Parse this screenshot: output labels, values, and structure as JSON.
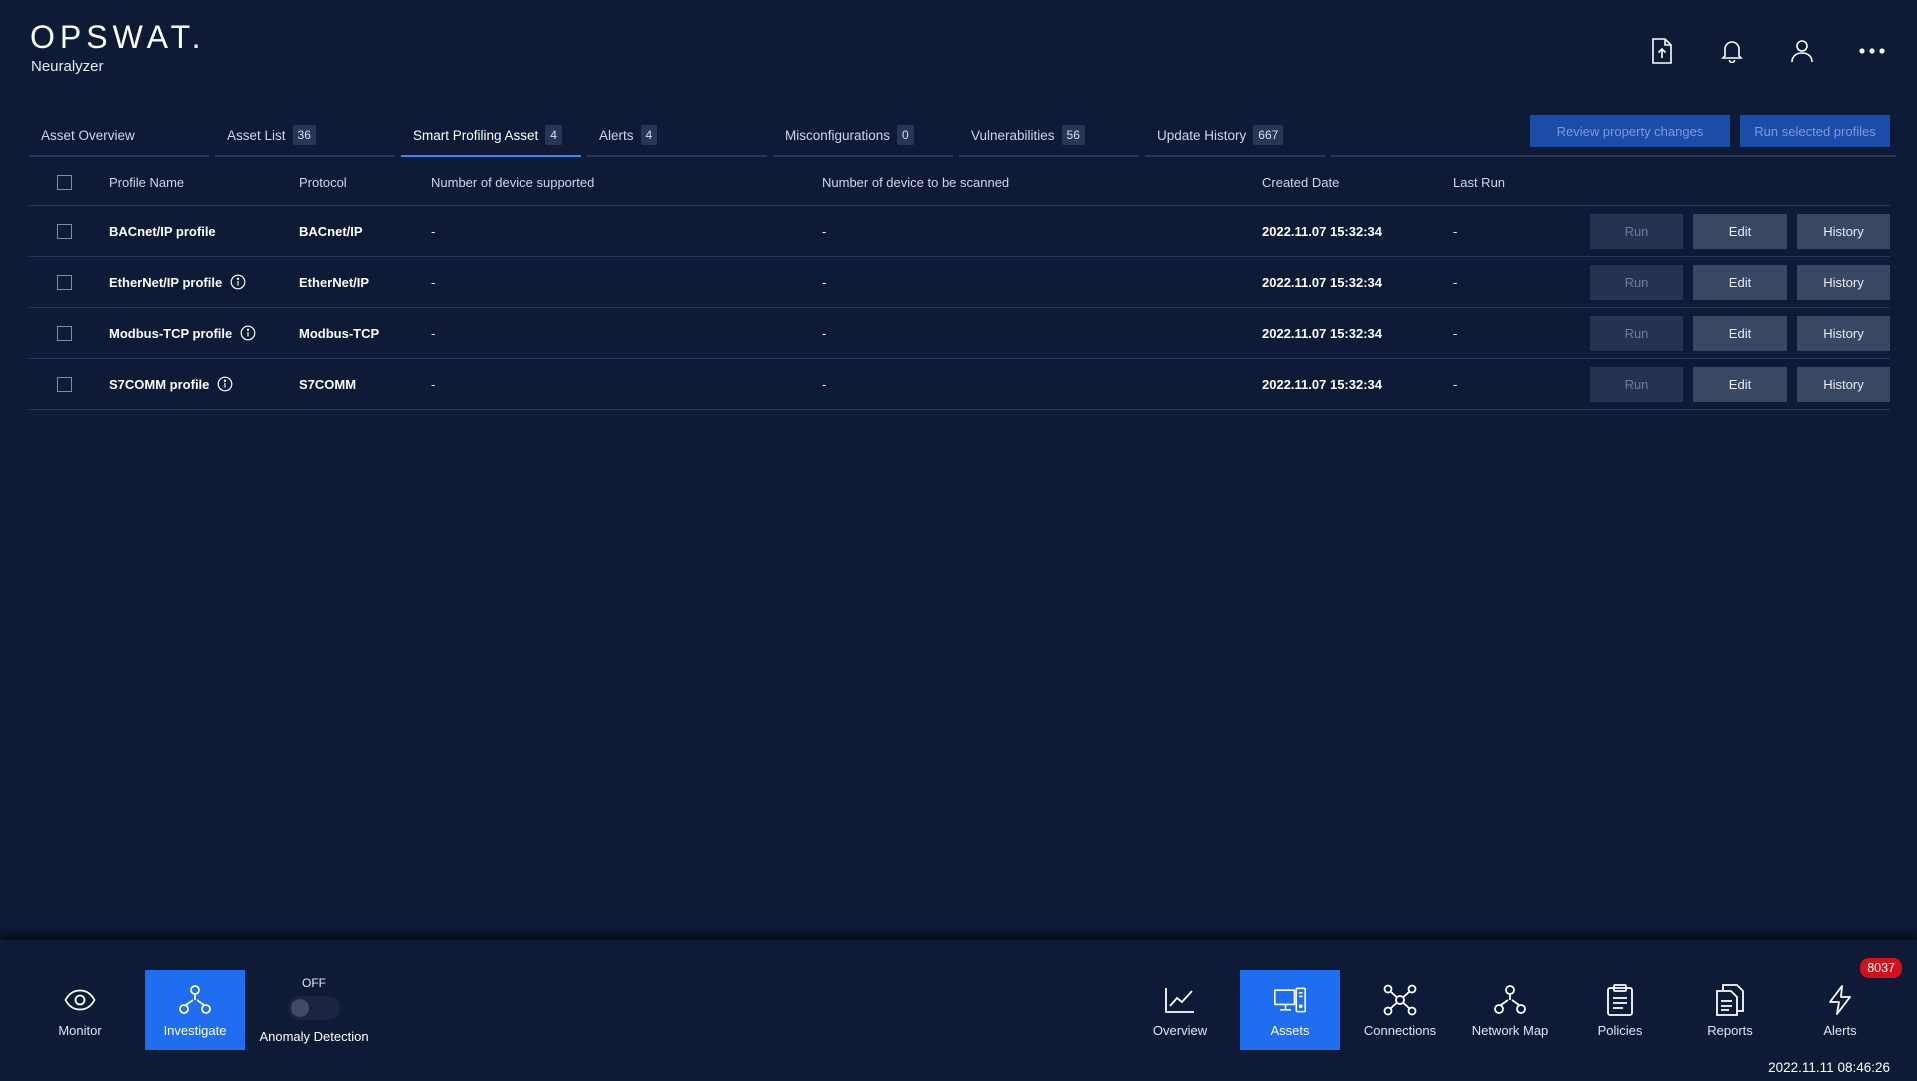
{
  "header": {
    "brand": "OPSWAT.",
    "product": "Neuralyzer",
    "icons": [
      "upload-file-icon",
      "bell-icon",
      "user-icon",
      "more-icon"
    ]
  },
  "tabs": [
    {
      "label": "Asset Overview",
      "count": ""
    },
    {
      "label": "Asset List",
      "count": "36"
    },
    {
      "label": "Smart Profiling Asset",
      "count": "4"
    },
    {
      "label": "Alerts",
      "count": "4"
    },
    {
      "label": "Misconfigurations",
      "count": "0"
    },
    {
      "label": "Vulnerabilities",
      "count": "56"
    },
    {
      "label": "Update History",
      "count": "667"
    }
  ],
  "actions": {
    "review": "Review property changes",
    "run_selected": "Run selected profiles"
  },
  "table": {
    "columns": {
      "profile_name": "Profile Name",
      "protocol": "Protocol",
      "num_supported": "Number of device supported",
      "num_scanned": "Number of device to be scanned",
      "created": "Created Date",
      "last_run": "Last Run"
    },
    "buttons": {
      "run": "Run",
      "edit": "Edit",
      "history": "History"
    },
    "rows": [
      {
        "name": "BACnet/IP profile",
        "info": false,
        "protocol": "BACnet/IP",
        "supported": "-",
        "scanned": "-",
        "created": "2022.11.07 15:32:34",
        "last_run": "-"
      },
      {
        "name": "EtherNet/IP profile",
        "info": true,
        "protocol": "EtherNet/IP",
        "supported": "-",
        "scanned": "-",
        "created": "2022.11.07 15:32:34",
        "last_run": "-"
      },
      {
        "name": "Modbus-TCP profile",
        "info": true,
        "protocol": "Modbus-TCP",
        "supported": "-",
        "scanned": "-",
        "created": "2022.11.07 15:32:34",
        "last_run": "-"
      },
      {
        "name": "S7COMM profile",
        "info": true,
        "protocol": "S7COMM",
        "supported": "-",
        "scanned": "-",
        "created": "2022.11.07 15:32:34",
        "last_run": "-"
      }
    ]
  },
  "bottom_nav": {
    "left": [
      {
        "label": "Monitor",
        "icon": "eye-icon",
        "active": false
      },
      {
        "label": "Investigate",
        "icon": "hierarchy-icon",
        "active": true
      }
    ],
    "anomaly": {
      "state": "OFF",
      "label": "Anomaly Detection"
    },
    "right": [
      {
        "label": "Overview",
        "icon": "line-chart-icon",
        "active": false
      },
      {
        "label": "Assets",
        "icon": "devices-icon",
        "active": true
      },
      {
        "label": "Connections",
        "icon": "connections-icon",
        "active": false
      },
      {
        "label": "Network Map",
        "icon": "network-map-icon",
        "active": false
      },
      {
        "label": "Policies",
        "icon": "clipboard-icon",
        "active": false
      },
      {
        "label": "Reports",
        "icon": "documents-icon",
        "active": false
      },
      {
        "label": "Alerts",
        "icon": "lightning-icon",
        "active": false
      }
    ],
    "alerts_count": "8037",
    "timestamp": "2022.11.11 08:46:26"
  },
  "colors": {
    "background": "#0e1a36",
    "accent": "#1f6ef0",
    "tab_active": "#2f86ff",
    "alert_badge": "#d4101a"
  }
}
